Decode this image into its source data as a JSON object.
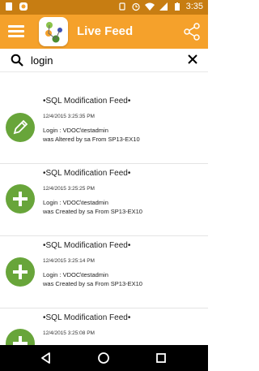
{
  "status_bar": {
    "time": "3:35",
    "icons": [
      "sim-icon",
      "app-notification-icon",
      "vibrate-icon",
      "alarm-icon",
      "wifi-icon",
      "signal-icon",
      "battery-icon"
    ]
  },
  "app_bar": {
    "title": "Live Feed",
    "menu_icon": "hamburger-menu-icon",
    "share_icon": "share-icon"
  },
  "search": {
    "value": "login"
  },
  "feed": [
    {
      "icon": "edit-icon",
      "title": "•SQL Modification Feed•",
      "time": "12/4/2015 3:25:35 PM",
      "line1": "Login : VDOC\\testadmin",
      "line2": "was Altered by sa From SP13-EX10"
    },
    {
      "icon": "plus-icon",
      "title": "•SQL Modification Feed•",
      "time": "12/4/2015 3:25:25 PM",
      "line1": "Login : VDOC\\testadmin",
      "line2": "was Created by sa From SP13-EX10"
    },
    {
      "icon": "plus-icon",
      "title": "•SQL Modification Feed•",
      "time": "12/4/2015 3:25:14 PM",
      "line1": "Login : VDOC\\testadmin",
      "line2": "was Created by sa From SP13-EX10"
    },
    {
      "icon": "plus-icon",
      "title": "•SQL Modification Feed•",
      "time": "12/4/2015 3:25:08 PM",
      "line1": "",
      "line2": ""
    }
  ],
  "colors": {
    "status_bar": "#c77d12",
    "app_bar": "#f5a12b",
    "feed_icon": "#68a53a",
    "nav_bar": "#000000"
  }
}
